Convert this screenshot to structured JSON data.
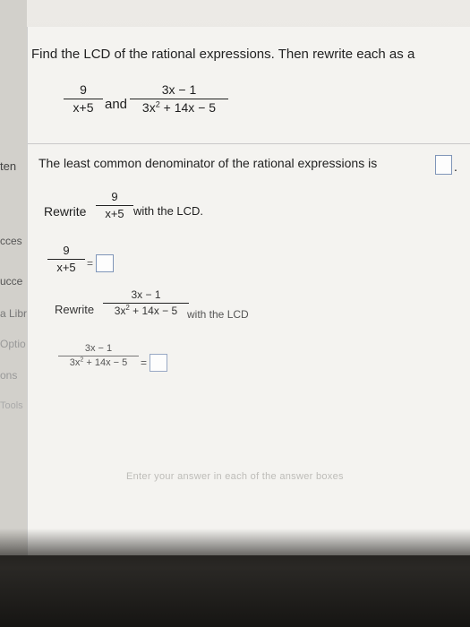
{
  "sidebar": {
    "items": [
      "ten",
      "cces",
      "ucce",
      "a Libr",
      "Optio",
      "ons",
      "Tools"
    ]
  },
  "problem": {
    "instruction": "Find the LCD of the rational expressions. Then rewrite each as a",
    "frac1": {
      "num": "9",
      "den": "x+5"
    },
    "and": "and",
    "frac2": {
      "num": "3x − 1",
      "den_pre": "3x",
      "den_exp": "2",
      "den_post": " + 14x − 5"
    }
  },
  "part1": {
    "prompt": "The least common denominator of the rational expressions is",
    "suffix": "."
  },
  "part2": {
    "rewrite": "Rewrite",
    "frac": {
      "num": "9",
      "den": "x+5"
    },
    "suffix": "with the LCD.",
    "answer_frac": {
      "num": "9",
      "den": "x+5"
    },
    "equals": "="
  },
  "part3": {
    "rewrite": "Rewrite",
    "frac": {
      "num": "3x − 1",
      "den_pre": "3x",
      "den_exp": "2",
      "den_post": " + 14x − 5"
    },
    "suffix": "with the LCD",
    "answer_frac": {
      "num": "3x − 1",
      "den_pre": "3x",
      "den_exp": "2",
      "den_post": " + 14x − 5"
    },
    "equals": "="
  },
  "footer": {
    "hint": "Enter your answer in each of the answer boxes"
  },
  "colors": {
    "answer_box_border": "#7f95b8",
    "page_bg": "#f4f3f0"
  }
}
